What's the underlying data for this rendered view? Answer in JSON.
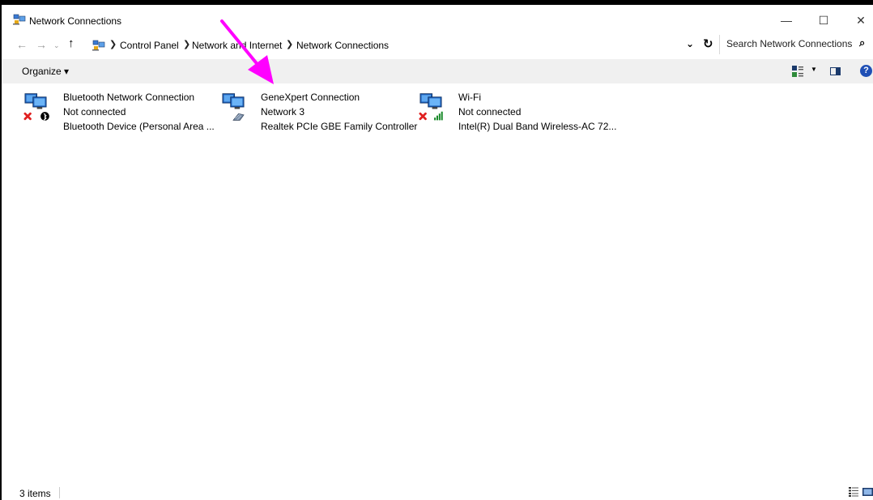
{
  "window": {
    "title": "Network Connections",
    "min_symbol": "—",
    "max_symbol": "☐",
    "close_symbol": "✕"
  },
  "nav": {
    "back": "←",
    "forward": "→",
    "recent": "⌄",
    "up": "↑",
    "dropdown": "⌄",
    "refresh": "↻"
  },
  "breadcrumb": [
    {
      "label": "Control Panel"
    },
    {
      "label": "Network and Internet"
    },
    {
      "label": "Network Connections"
    }
  ],
  "breadcrumb_sep": "❯",
  "search": {
    "placeholder": "Search Network Connections",
    "icon": "⌕"
  },
  "toolbar": {
    "organize": "Organize ▾",
    "view_dropdown": "▼",
    "help": "?"
  },
  "connections": [
    {
      "name": "Bluetooth Network Connection",
      "status": "Not connected",
      "device": "Bluetooth Device (Personal Area ...",
      "icon": "bluetooth-icon",
      "state": "disconnected"
    },
    {
      "name": "GeneXpert Connection",
      "status": "Network  3",
      "device": "Realtek PCIe GBE Family Controller",
      "icon": "ethernet-icon",
      "state": "connected"
    },
    {
      "name": "Wi-Fi",
      "status": "Not connected",
      "device": "Intel(R) Dual Band Wireless-AC 72...",
      "icon": "wifi-signal-icon",
      "state": "disconnected"
    }
  ],
  "status": {
    "count": "3 items"
  },
  "colors": {
    "annotation_arrow": "#ff00ff",
    "disconnected_x": "#e02020",
    "help_blue": "#1f4fb5",
    "toolbar_bg": "#f0f0f0"
  }
}
